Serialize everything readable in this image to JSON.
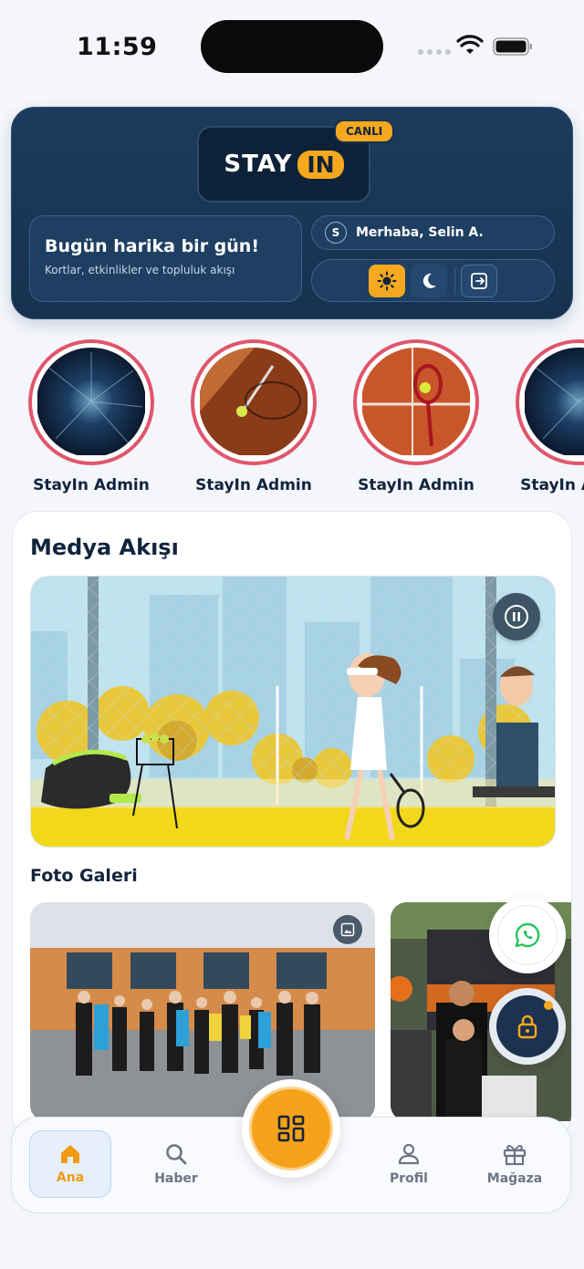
{
  "status_bar": {
    "time": "11:59"
  },
  "header": {
    "logo_stay": "STAY",
    "logo_in": "IN",
    "live_badge": "CANLI",
    "greeting_title": "Bugün harika bir gün!",
    "greeting_subtitle": "Kortlar, etkinlikler ve topluluk akışı",
    "user_initial": "S",
    "user_greeting": "Merhaba, Selin A."
  },
  "stories": [
    {
      "name": "StayIn Admin",
      "image": "abstract-blue"
    },
    {
      "name": "StayIn Admin",
      "image": "tennis-ball-court"
    },
    {
      "name": "StayIn Admin",
      "image": "tennis-racket-clay"
    },
    {
      "name": "StayIn Admin",
      "image": "abstract-blue"
    }
  ],
  "media": {
    "title": "Medya Akışı",
    "gallery_title": "Foto Galeri"
  },
  "nav": {
    "home": "Ana",
    "news": "Haber",
    "profile": "Profil",
    "store": "Mağaza"
  },
  "colors": {
    "accent": "#f6a81e",
    "header_bg": "#1a3858",
    "story_ring": "#e0566c"
  }
}
